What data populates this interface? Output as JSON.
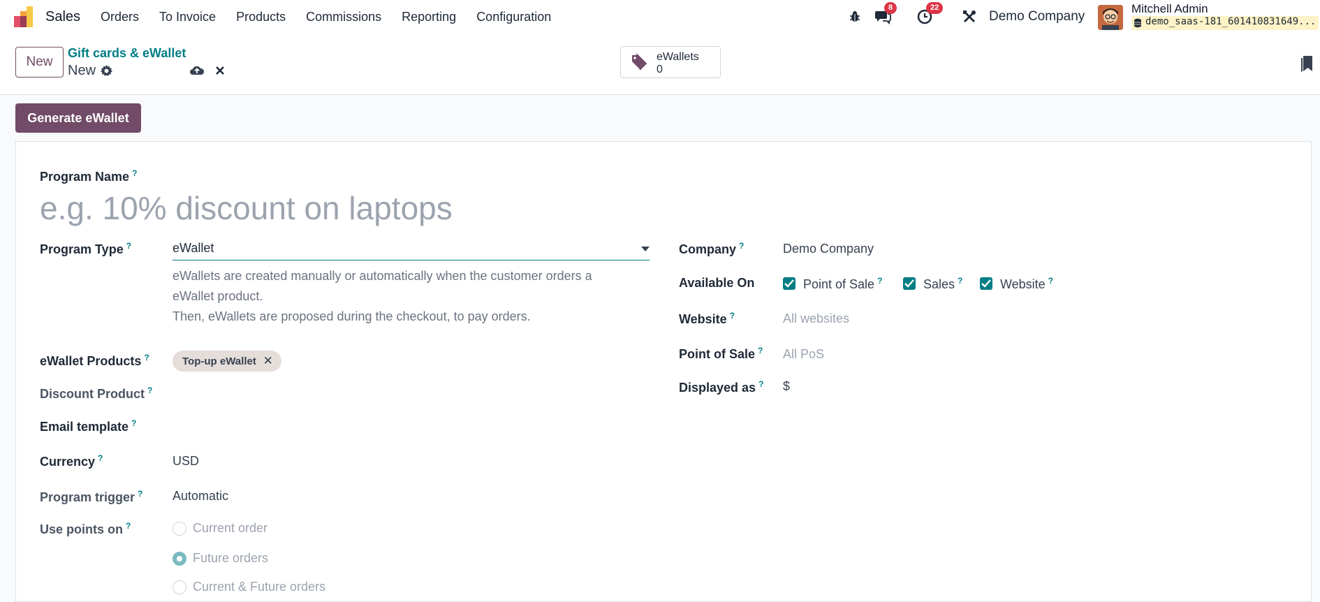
{
  "navbar": {
    "app_name": "Sales",
    "menu": [
      "Orders",
      "To Invoice",
      "Products",
      "Commissions",
      "Reporting",
      "Configuration"
    ],
    "messages_count": "8",
    "activities_count": "22",
    "company": "Demo Company",
    "user_name": "Mitchell Admin",
    "database": "demo_saas-181_601410831649..."
  },
  "control": {
    "new_label": "New",
    "breadcrumb": "Gift cards & eWallet",
    "record_name": "New",
    "smart_button": {
      "label": "eWallets",
      "value": "0"
    }
  },
  "form": {
    "generate_label": "Generate eWallet",
    "program_name_label": "Program Name",
    "program_name_placeholder": "e.g. 10% discount on laptops",
    "program_type_label": "Program Type",
    "program_type_value": "eWallet",
    "program_type_help": [
      "eWallets are created manually or automatically when the customer orders a",
      "eWallet product.",
      "Then, eWallets are proposed during the checkout, to pay orders."
    ],
    "ewallet_products_label": "eWallet Products",
    "ewallet_products_tag": "Top-up eWallet",
    "discount_product_label": "Discount Product",
    "email_template_label": "Email template",
    "currency_label": "Currency",
    "currency_value": "USD",
    "program_trigger_label": "Program trigger",
    "program_trigger_value": "Automatic",
    "use_points_label": "Use points on",
    "use_points_options": [
      {
        "label": "Current order",
        "selected": false
      },
      {
        "label": "Future orders",
        "selected": true
      },
      {
        "label": "Current & Future orders",
        "selected": false
      }
    ],
    "company_label": "Company",
    "company_value": "Demo Company",
    "available_on_label": "Available On",
    "available_on_options": [
      {
        "label": "Point of Sale",
        "checked": true
      },
      {
        "label": "Sales",
        "checked": true
      },
      {
        "label": "Website",
        "checked": true
      }
    ],
    "website_label": "Website",
    "website_placeholder": "All websites",
    "pos_label": "Point of Sale",
    "pos_placeholder": "All PoS",
    "displayed_as_label": "Displayed as",
    "displayed_as_value": "$",
    "help_mark": "?"
  },
  "colors": {
    "primary": "#714b67",
    "teal": "#017e84",
    "badge": "#dc3545"
  }
}
